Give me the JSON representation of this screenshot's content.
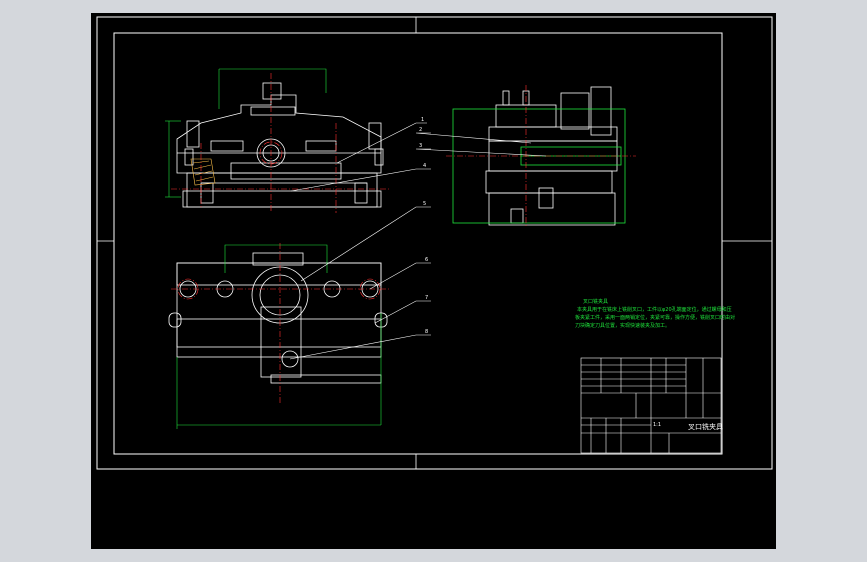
{
  "notes": {
    "title": "叉口铣夹具",
    "body": "本夹具用于在铣床上铣削叉口，工件以φ20孔端面定位，通过螺母和压板夹紧工件，采用一面两销定位，夹紧可靠，操作方便，铣削叉口时由对刀块确定刀具位置，实现快速装夹及加工。"
  },
  "title_block": {
    "drawing_name": "叉口铣夹具",
    "scale": "1:1"
  },
  "balloons": [
    "1",
    "2",
    "3",
    "4",
    "5",
    "6",
    "7",
    "8"
  ],
  "colors": {
    "background": "#000000",
    "outline": "#ffffff",
    "dimension": "#1ee63c",
    "centerline": "#ff3030",
    "note_text": "#1ee63c"
  }
}
